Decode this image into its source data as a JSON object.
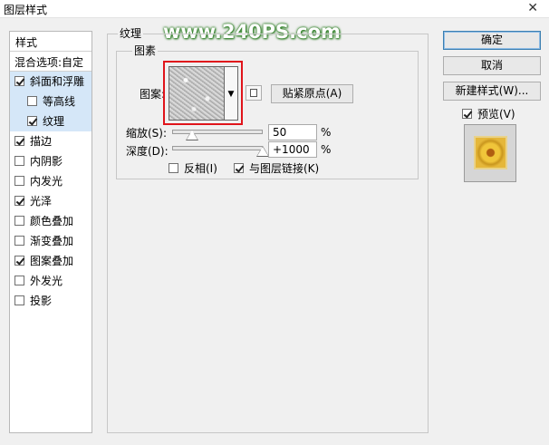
{
  "window": {
    "title": "图层样式",
    "close_glyph": "✕"
  },
  "watermark": "www.240PS.com",
  "styles": {
    "header": "样式",
    "blend_options": "混合选项:自定",
    "items": [
      {
        "label": "斜面和浮雕",
        "checked": true,
        "sub": false,
        "active": true
      },
      {
        "label": "等高线",
        "checked": false,
        "sub": true,
        "active": true
      },
      {
        "label": "纹理",
        "checked": true,
        "sub": true,
        "active": true
      },
      {
        "label": "描边",
        "checked": true,
        "sub": false,
        "active": false
      },
      {
        "label": "内阴影",
        "checked": false,
        "sub": false,
        "active": false
      },
      {
        "label": "内发光",
        "checked": false,
        "sub": false,
        "active": false
      },
      {
        "label": "光泽",
        "checked": true,
        "sub": false,
        "active": false
      },
      {
        "label": "颜色叠加",
        "checked": false,
        "sub": false,
        "active": false
      },
      {
        "label": "渐变叠加",
        "checked": false,
        "sub": false,
        "active": false
      },
      {
        "label": "图案叠加",
        "checked": true,
        "sub": false,
        "active": false
      },
      {
        "label": "外发光",
        "checked": false,
        "sub": false,
        "active": false
      },
      {
        "label": "投影",
        "checked": false,
        "sub": false,
        "active": false
      }
    ]
  },
  "texture": {
    "group_title": "纹理",
    "pattern_group_title": "图素",
    "pattern_label": "图案:",
    "snap_origin_button": "贴紧原点(A)",
    "scale_label": "缩放(S):",
    "scale_value": "50",
    "scale_unit": "%",
    "scale_fraction": 0.1,
    "depth_label": "深度(D):",
    "depth_value": "+1000",
    "depth_unit": "%",
    "depth_fraction": 1.0,
    "invert_label": "反相(I)",
    "invert_checked": false,
    "link_label": "与图层链接(K)",
    "link_checked": true,
    "dropdown_glyph": "▼"
  },
  "right_panel": {
    "ok_button": "确定",
    "cancel_button": "取消",
    "new_style_button": "新建样式(W)...",
    "preview_label": "预览(V)",
    "preview_checked": true
  },
  "colors": {
    "highlight": "#e0141b",
    "selected_row": "#cce4f7",
    "watermark_outline": "#2e7e25"
  }
}
